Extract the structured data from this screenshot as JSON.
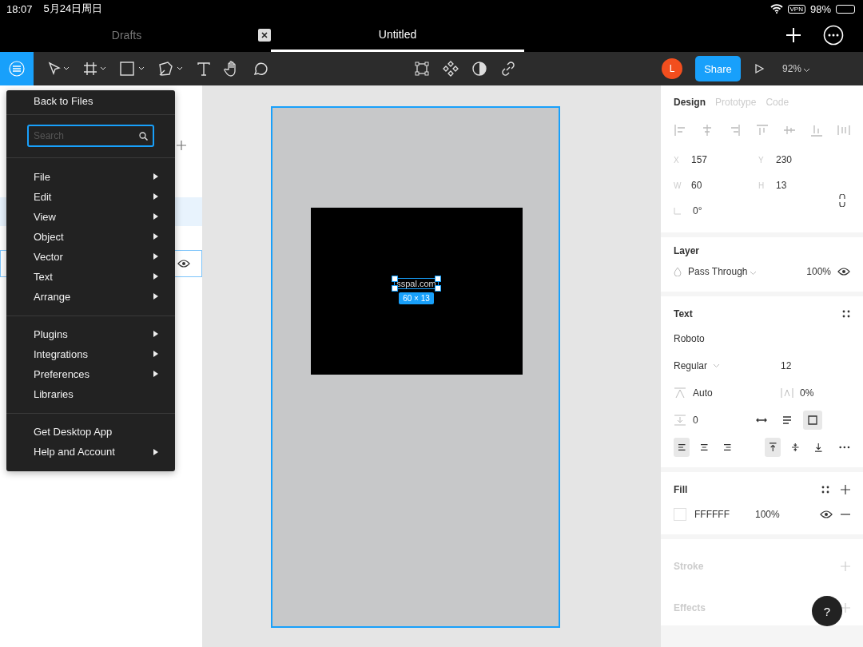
{
  "status_bar": {
    "time": "18:07",
    "date": "5月24日周日",
    "vpn": "VPN",
    "battery": "98%"
  },
  "file_tabs": [
    {
      "label": "Drafts",
      "selected": false
    },
    {
      "label": "Untitled",
      "selected": true
    }
  ],
  "toolbar": {
    "avatar": "L",
    "share": "Share",
    "zoom": "92%"
  },
  "menu": {
    "back": "Back to Files",
    "search_placeholder": "Search",
    "groups": [
      [
        {
          "label": "File",
          "submenu": true
        },
        {
          "label": "Edit",
          "submenu": true
        },
        {
          "label": "View",
          "submenu": true
        },
        {
          "label": "Object",
          "submenu": true
        },
        {
          "label": "Vector",
          "submenu": true
        },
        {
          "label": "Text",
          "submenu": true
        },
        {
          "label": "Arrange",
          "submenu": true
        }
      ],
      [
        {
          "label": "Plugins",
          "submenu": true
        },
        {
          "label": "Integrations",
          "submenu": true
        },
        {
          "label": "Preferences",
          "submenu": true
        },
        {
          "label": "Libraries",
          "submenu": false
        }
      ],
      [
        {
          "label": "Get Desktop App",
          "submenu": false
        },
        {
          "label": "Help and Account",
          "submenu": true
        }
      ]
    ]
  },
  "canvas": {
    "text_layer": "sspal.com",
    "size": "60 × 13"
  },
  "design_panel": {
    "tabs": [
      {
        "label": "Design",
        "selected": true
      },
      {
        "label": "Prototype",
        "selected": false
      },
      {
        "label": "Code",
        "selected": false
      }
    ],
    "fields": [
      {
        "label": "X",
        "value": "157"
      },
      {
        "label": "Y",
        "value": "230"
      },
      {
        "label": "W",
        "value": "60"
      },
      {
        "label": "H",
        "value": "13"
      }
    ],
    "rotation": "0°",
    "layer": {
      "title": "Layer",
      "blend": "Pass Through",
      "opacity": "100%"
    },
    "text": {
      "title": "Text",
      "font": "Roboto",
      "style": "Regular",
      "size": "12",
      "line_height": "Auto",
      "letter_spacing": "0%",
      "paragraph_spacing": "0",
      "resize": [
        {
          "kind": "width",
          "selected": false
        },
        {
          "kind": "height",
          "selected": false
        },
        {
          "kind": "fixed",
          "selected": true
        }
      ],
      "align_h": [
        {
          "kind": "left",
          "selected": true
        },
        {
          "kind": "center",
          "selected": false
        },
        {
          "kind": "right",
          "selected": false
        }
      ],
      "align_v": [
        {
          "kind": "top",
          "selected": true
        },
        {
          "kind": "middle",
          "selected": false
        },
        {
          "kind": "bottom",
          "selected": false
        }
      ]
    },
    "fill": {
      "title": "Fill",
      "hex": "FFFFFF",
      "opacity": "100%"
    },
    "stroke": {
      "title": "Stroke"
    },
    "effects": {
      "title": "Effects"
    }
  },
  "help": "?"
}
